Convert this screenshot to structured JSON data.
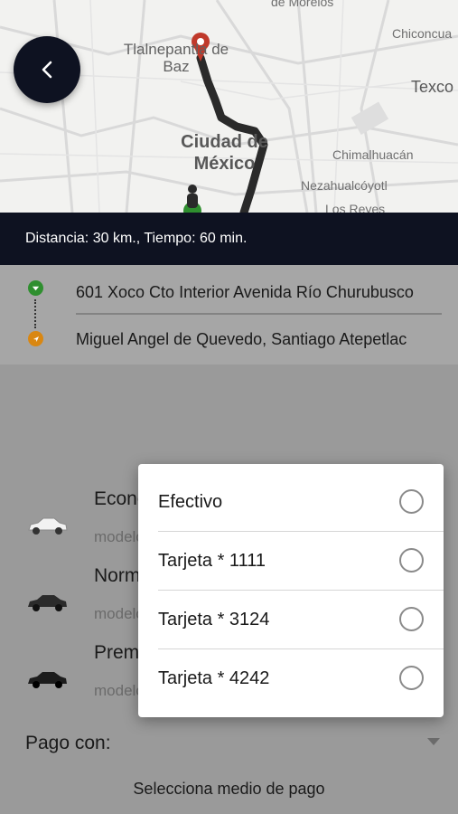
{
  "map": {
    "labels": {
      "tlalnepantla": "Tlalnepantla de Baz",
      "ciudad_mexico": "Ciudad de México",
      "chiconcuac": "Chiconcua",
      "texcoco": "Texco",
      "chimalhuacan": "Chimalhuacán",
      "nezahualcoyotl": "Nezahualcóyotl",
      "los_reyes": "Los Reyes",
      "morelos": "de Morelos"
    }
  },
  "route": {
    "distance_text": "Distancia: 30 km., Tiempo: 60 min.",
    "origin": "601 Xoco Cto Interior Avenida Río Churubusco",
    "destination": "Miguel Angel de Quevedo, Santiago Atepetlac"
  },
  "vehicles": [
    {
      "name": "Economico",
      "model": "modelo",
      "color": "#f2f2f2"
    },
    {
      "name": "Normal",
      "model": "modelo",
      "color": "#2b2b2b"
    },
    {
      "name": "Premium",
      "model": "modelo",
      "color": "#1c1c1c"
    }
  ],
  "payment": {
    "label": "Pago con:",
    "hint": "Selecciona medio de pago",
    "options": [
      "Efectivo",
      "Tarjeta * 1111",
      "Tarjeta * 3124",
      "Tarjeta * 4242"
    ]
  },
  "colors": {
    "dark": "#0e1221",
    "origin_pin": "#2f8f2f",
    "destination_pin": "#d98712",
    "route_line": "#2a2a2a",
    "destination_marker": "#c0392b"
  },
  "icons": {
    "back": "chevron-left-icon",
    "origin": "origin-pin-icon",
    "destination": "navigation-arrow-icon",
    "car": "car-icon",
    "dropdown": "triangle-down-icon",
    "radio": "radio-empty-icon"
  }
}
